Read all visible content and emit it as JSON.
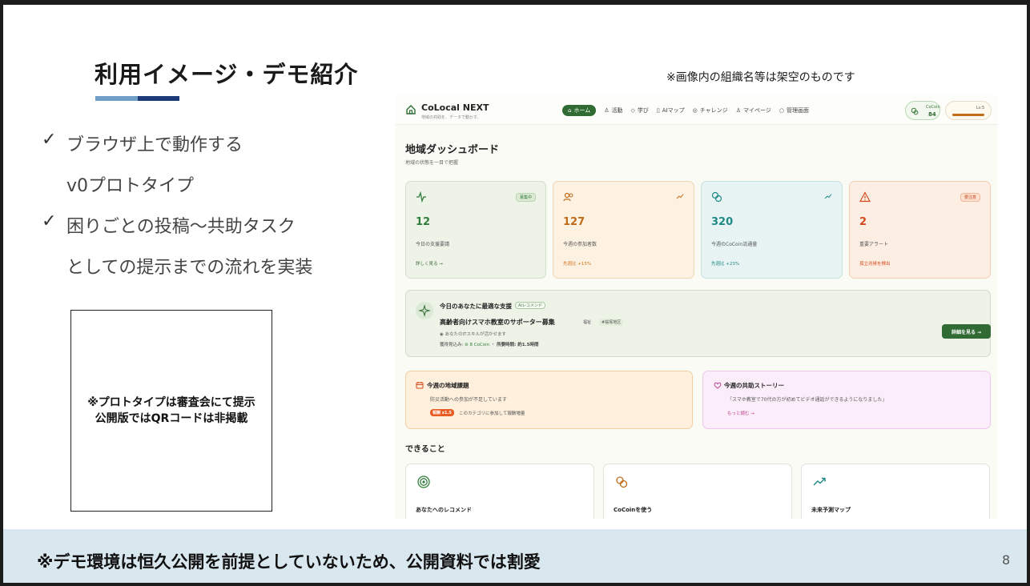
{
  "slide": {
    "title": "利用イメージ・デモ紹介",
    "note_top": "※画像内の組織名等は架空のものです",
    "bullets": [
      {
        "check": "✓",
        "lines": [
          "ブラウザ上で動作する",
          "v0プロトタイプ"
        ]
      },
      {
        "check": "✓",
        "lines": [
          "困りごとの投稿〜共助タスク",
          "としての提示までの流れを実装"
        ]
      }
    ],
    "qr_note_line1": "※プロトタイプは審査会にて提示",
    "qr_note_line2": "公開版ではQRコードは非掲載",
    "bottom_text": "※デモ環境は恒久公開を前提としていないため、公開資料では割愛",
    "page_number": "8",
    "colors": {
      "accent_light": "#6f9fc6",
      "accent_dark": "#1f3a78",
      "band": "#d9e7ef"
    }
  },
  "app": {
    "logo_title": "CoLocal NEXT",
    "logo_sub": "地域の共助を、データで動かす。",
    "nav": [
      {
        "label": "ホーム",
        "icon": "home-icon",
        "active": true
      },
      {
        "label": "活動",
        "icon": "users-icon"
      },
      {
        "label": "学び",
        "icon": "book-icon"
      },
      {
        "label": "AIマップ",
        "icon": "map-icon"
      },
      {
        "label": "チャレンジ",
        "icon": "target-icon"
      },
      {
        "label": "マイページ",
        "icon": "user-icon"
      },
      {
        "label": "管理画面",
        "icon": "gear-icon"
      }
    ],
    "coin_label": "CoCoin",
    "coin_value": "84",
    "level_label": "Lv.5",
    "dashboard_title": "地域ダッシュボード",
    "dashboard_sub": "地域の状態を一目で把握",
    "stats": [
      {
        "value": "12",
        "label": "今日の支援要請",
        "badge": "募集中",
        "foot": "詳しく見る →",
        "color": "#2f7d3a",
        "foot_color": "#3a6b3a"
      },
      {
        "value": "127",
        "label": "今週の参加者数",
        "foot": "先週比 +15%",
        "color": "#c06b18",
        "foot_color": "#d0741c"
      },
      {
        "value": "320",
        "label": "今週のCoCoin流通量",
        "foot": "先週比 +23%",
        "color": "#1f8a86",
        "foot_color": "#1f8a86"
      },
      {
        "value": "2",
        "label": "重要アラート",
        "badge": "要注意",
        "foot": "孤立兆候を検出",
        "color": "#d2491c",
        "foot_color": "#d2491c"
      }
    ],
    "recommend": {
      "title": "今日のあなたに最適な支援",
      "badge": "AIレコメンド",
      "headline": "高齢者向けスマホ教室のサポーター募集",
      "tag1": "福祉",
      "tag2": "#桜塚地区",
      "desc": "あなたのITスキルが活かせます",
      "meta_prefix": "獲得見込み:",
      "meta_coin": "8 CoCoin",
      "meta_sep": "・",
      "meta_time": "所要時間: 約1.5時間",
      "button": "詳細を見る →"
    },
    "issue": {
      "title": "今週の地域課題",
      "text": "防災活動への参加が不足しています",
      "pill": "報酬 x1.5",
      "foot": "このカテゴリに参加して報酬増量"
    },
    "story": {
      "title": "今週の共助ストーリー",
      "text": "「スマホ教室で70代の方が初めてビデオ通話ができるようになりました」",
      "foot": "もっと読む →"
    },
    "can_title": "できること",
    "features": [
      {
        "title": "あなたへのレコメンド",
        "icon": "target-icon"
      },
      {
        "title": "CoCoinを使う",
        "icon": "coins-icon"
      },
      {
        "title": "未来予測マップ",
        "icon": "trend-up-icon"
      }
    ]
  }
}
